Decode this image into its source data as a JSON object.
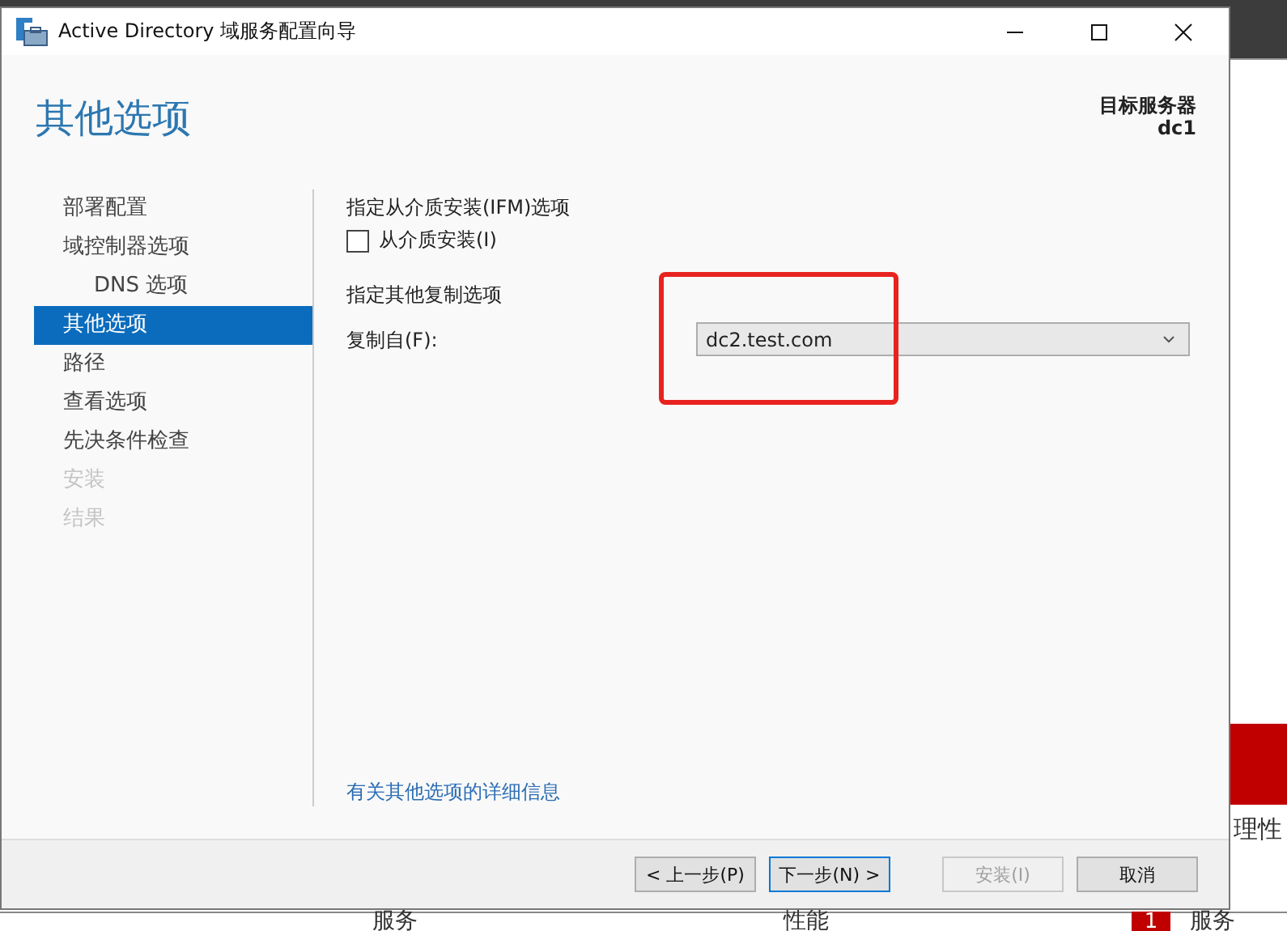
{
  "background": {
    "side_labels": [
      "理性"
    ],
    "bottom_cells": [
      "服务",
      "性能"
    ],
    "badge": "1",
    "badge_label": "服务"
  },
  "window": {
    "title": "Active Directory 域服务配置向导"
  },
  "header": {
    "title": "其他选项",
    "target_label": "目标服务器",
    "target_value": "dc1"
  },
  "sidebar": {
    "items": [
      {
        "label": "部署配置",
        "selected": false,
        "disabled": false
      },
      {
        "label": "域控制器选项",
        "selected": false,
        "disabled": false,
        "children": [
          {
            "label": "DNS 选项",
            "selected": false,
            "disabled": false
          }
        ]
      },
      {
        "label": "其他选项",
        "selected": true,
        "disabled": false
      },
      {
        "label": "路径",
        "selected": false,
        "disabled": false
      },
      {
        "label": "查看选项",
        "selected": false,
        "disabled": false
      },
      {
        "label": "先决条件检查",
        "selected": false,
        "disabled": false
      },
      {
        "label": "安装",
        "selected": false,
        "disabled": true
      },
      {
        "label": "结果",
        "selected": false,
        "disabled": true
      }
    ]
  },
  "content": {
    "ifm_heading": "指定从介质安装(IFM)选项",
    "ifm_checkbox": {
      "label": "从介质安装(I)",
      "checked": false
    },
    "replication_heading": "指定其他复制选项",
    "replicate_from": {
      "label": "复制自(F):",
      "value": "dc2.test.com"
    },
    "link": "有关其他选项的详细信息"
  },
  "buttons": [
    {
      "label": "< 上一步(P)",
      "disabled": false,
      "focused": false
    },
    {
      "label": "下一步(N) >",
      "disabled": false,
      "focused": true
    },
    {
      "label": "安装(I)",
      "disabled": true,
      "focused": false
    },
    {
      "label": "取消",
      "disabled": false,
      "focused": false
    }
  ],
  "annotation": {
    "color": "#e8231f"
  }
}
